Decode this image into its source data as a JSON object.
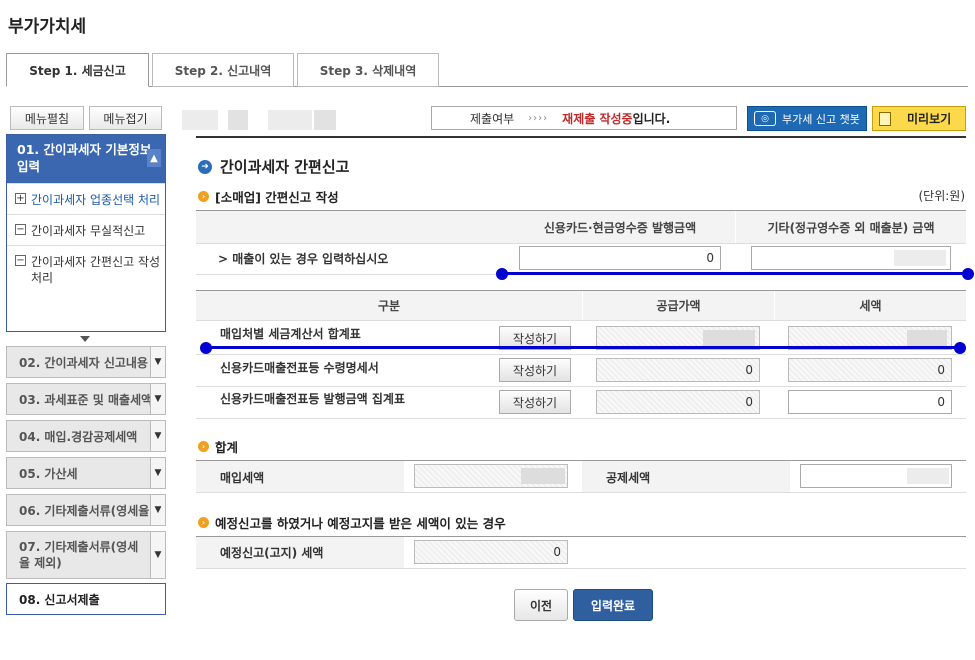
{
  "page_title": "부가가치세",
  "tabs": [
    {
      "label": "Step 1. 세금신고",
      "active": true
    },
    {
      "label": "Step 2. 신고내역",
      "active": false
    },
    {
      "label": "Step 3. 삭제내역",
      "active": false
    }
  ],
  "sidebar": {
    "expand_all": "메뉴펼침",
    "collapse_all": "메뉴접기",
    "current": {
      "label": "01. 간이과세자 기본정보 입력",
      "items": [
        {
          "label": "간이과세자 업종선택 처리",
          "icon": "plus"
        },
        {
          "label": "간이과세자 무실적신고",
          "icon": "minus"
        },
        {
          "label": "간이과세자 간편신고 작성 처리",
          "icon": "minus"
        }
      ]
    },
    "steps": [
      {
        "label": "02. 간이과세자 신고내용"
      },
      {
        "label": "03. 과세표준 및 매출세액"
      },
      {
        "label": "04. 매입.경감공제세액"
      },
      {
        "label": "05. 가산세"
      },
      {
        "label": "06. 기타제출서류(영세율)"
      },
      {
        "label": "07. 기타제출서류(영세율 제외)"
      },
      {
        "label": "08. 신고서제출"
      }
    ]
  },
  "status": {
    "label": "제출여부",
    "arrows": "››››",
    "value": "재제출 작성중",
    "tail": "입니다."
  },
  "chatbot_button": "부가세 신고 챗봇",
  "preview_button": "미리보기",
  "section_title": "간이과세자 간편신고",
  "sales_section": {
    "title": "[소매업] 간편신고 작성",
    "unit": "(단위:원)",
    "col_card": "신용카드·현금영수증 발행금액",
    "col_other": "기타(정규영수증 외 매출분) 금액",
    "row_label": "> 매출이 있는 경우 입력하십시오",
    "card_value": "0",
    "other_value": ""
  },
  "purchase_table": {
    "col_category": "구분",
    "col_supply": "공급가액",
    "col_tax": "세액",
    "write_label": "작성하기",
    "rows": [
      {
        "label": "매입처별 세금계산서 합계표",
        "supply": "",
        "tax": ""
      },
      {
        "label": "신용카드매출전표등 수령명세서",
        "supply": "0",
        "tax": "0"
      },
      {
        "label": "신용카드매출전표등 발행금액 집계표",
        "supply": "0",
        "tax": "0"
      }
    ]
  },
  "total_section": {
    "title": "합계",
    "purchase_tax_label": "매입세액",
    "purchase_tax_value": "",
    "deduct_tax_label": "공제세액",
    "deduct_tax_value": ""
  },
  "prelim_section": {
    "title": "예정신고를 하였거나 예정고지를 받은 세액이 있는 경우",
    "label": "예정신고(고지) 세액",
    "value": "0"
  },
  "buttons": {
    "prev": "이전",
    "complete": "입력완료"
  },
  "colors": {
    "accent": "#3a67b0",
    "status_red": "#c0282a",
    "complete_btn": "#2f5f9f",
    "preview_btn": "#fcd94a",
    "annotation_line": "#0000d0"
  }
}
